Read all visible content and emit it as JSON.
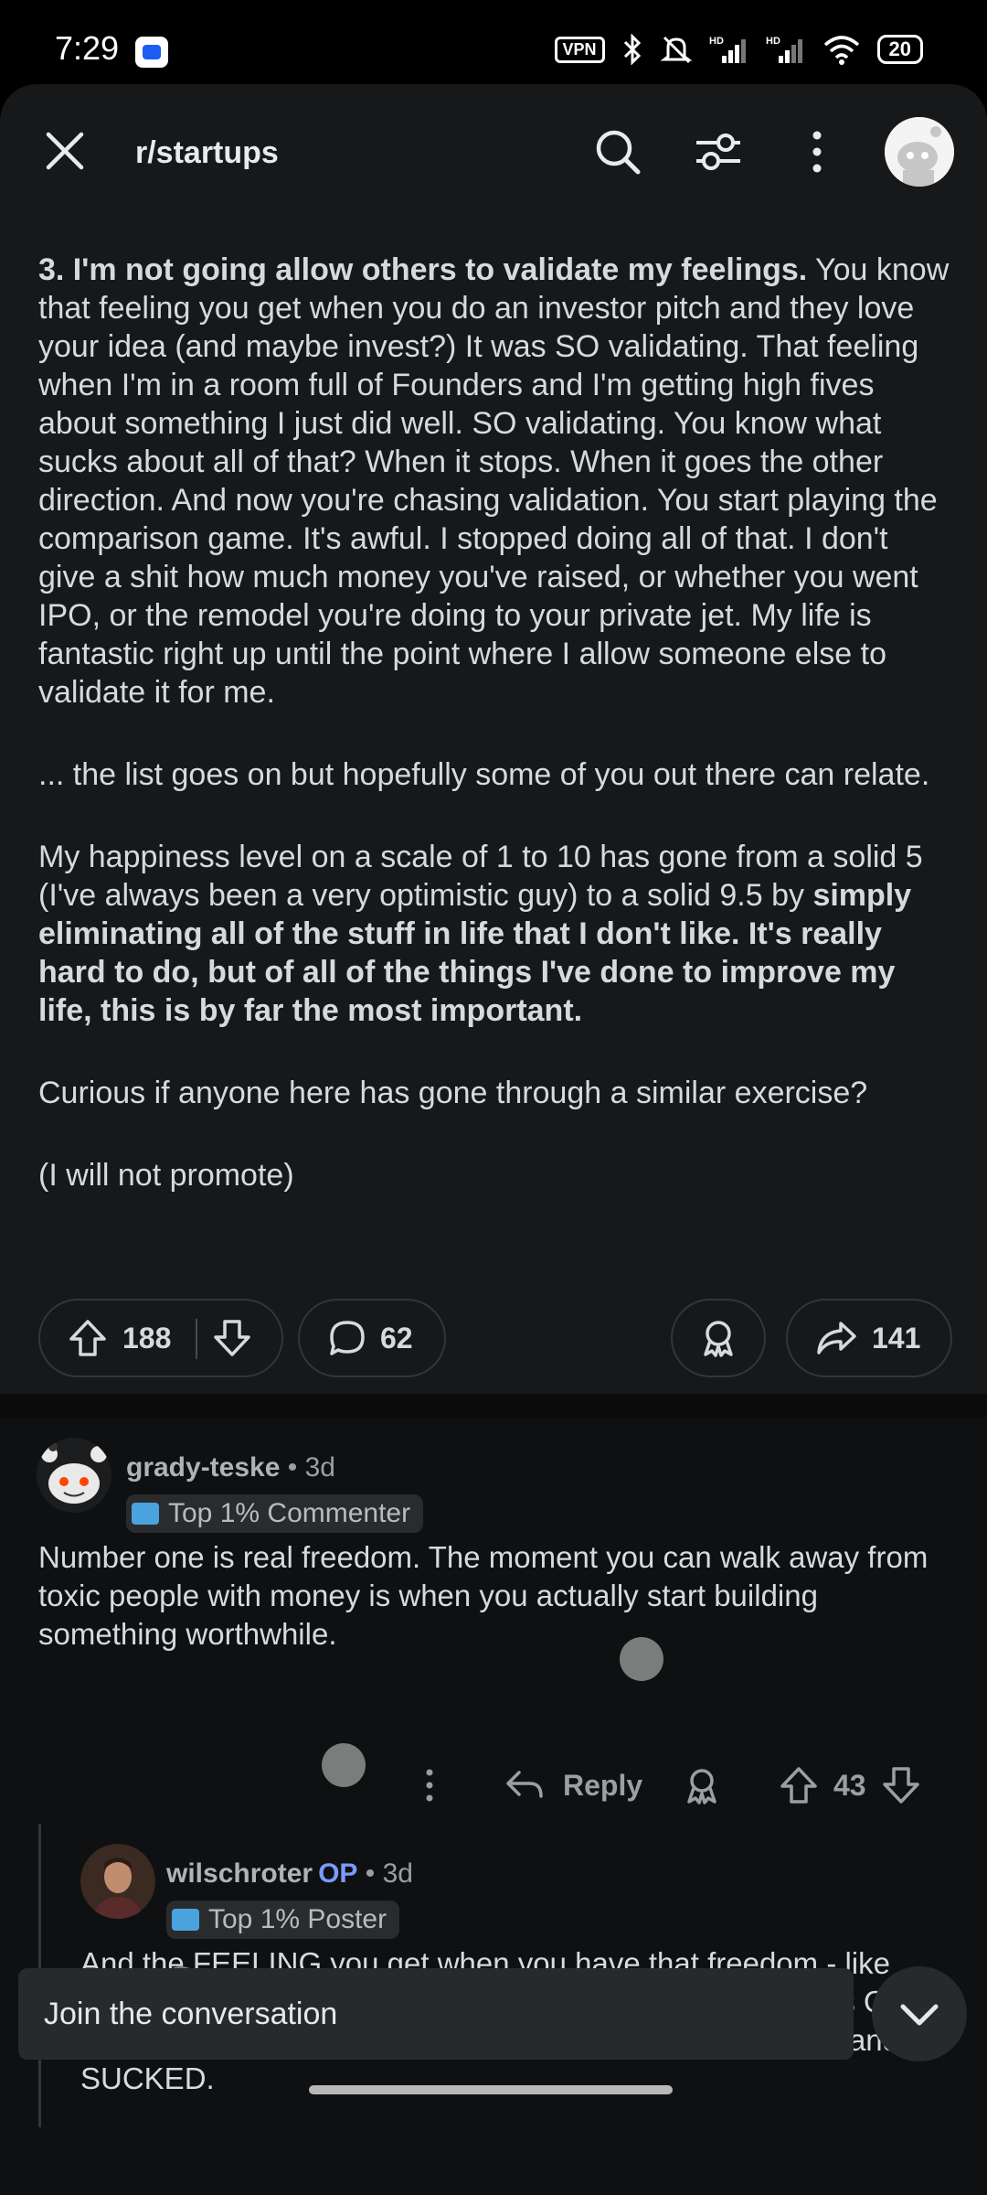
{
  "status_bar": {
    "time": "7:29",
    "vpn": "VPN",
    "battery": "20",
    "icons": [
      "app-icon",
      "vpn-icon",
      "bluetooth-icon",
      "mute-icon",
      "signal-icon",
      "signal-icon",
      "wifi-icon",
      "battery-icon"
    ]
  },
  "header": {
    "subreddit": "r/startups",
    "icons": [
      "close-icon",
      "search-icon",
      "filter-icon",
      "more-icon",
      "avatar"
    ]
  },
  "post": {
    "p1_bold": "3. I'm not going allow others to validate my feelings.",
    "p1_rest": " You know that feeling you get when you do an investor pitch and they love your idea (and maybe invest?) It was SO validating. That feeling when I'm in a room full of Founders and I'm getting high fives about something I just did well. SO validating. You know what sucks about all of that? When it stops. When it goes the other direction. And now you're chasing validation. You start playing the comparison game. It's awful. I stopped doing all of that. I don't give a shit how much money you've raised, or whether you went IPO, or the remodel you're doing to your private jet. My life is fantastic right up until the point where I allow someone else to validate it for me.",
    "p2": "... the list goes on but hopefully some of you out there can relate.",
    "p3_start": "My happiness level on a scale of 1 to 10 has gone from a solid 5 (I've always been a very optimistic guy) to a solid 9.5 by ",
    "p3_bold": "simply eliminating all of the stuff in life that I don't like. It's really hard to do, but of all of the things I've done to improve my life, this is by far the most important.",
    "p4": "Curious if anyone here has gone through a similar exercise?",
    "p5": "(I will not promote)",
    "upvotes": "188",
    "comments": "62",
    "shares": "141"
  },
  "comments": [
    {
      "user": "grady-teske",
      "age": "• 3d",
      "flair": "Top 1% Commenter",
      "body": "Number one is real freedom. The moment you can walk away from toxic people with money is when you actually start building something worthwhile.",
      "reply_label": "Reply",
      "score": "43"
    },
    {
      "user": "wilschroter",
      "op_tag": "OP",
      "age": "• 3d",
      "flair": "Top 1% Poster",
      "body": "And the FEELING you get when you have that freedom - like holy shit. You realize that you can just \"walk away\" and it's OK. I was at a point for a long time where that wasn't an option and it SUCKED."
    }
  ],
  "composer": {
    "placeholder": "Join the conversation"
  },
  "colors": {
    "background": "#0b0b0c",
    "post_background": "#161819",
    "text": "#d7dadc",
    "op_accent": "#7a9bff",
    "pill_border": "#343536"
  }
}
